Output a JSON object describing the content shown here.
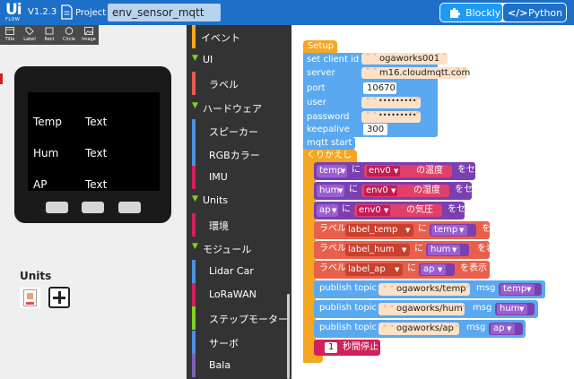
{
  "header": {
    "logo_main": "Ui",
    "logo_sub": "FLOW",
    "version": "V1.2.3",
    "project_label": "Project",
    "project_name": "env_sensor_mqtt",
    "mode_blockly": "Blockly",
    "mode_python": "Python"
  },
  "toolbox": {
    "title": "Title",
    "label": "Label",
    "rect": "Rect",
    "circle": "Circle",
    "image": "Image"
  },
  "screen": {
    "labels": [
      "Temp",
      "Hum",
      "AP"
    ],
    "values": [
      "Text",
      "Text",
      "Text"
    ]
  },
  "units": {
    "title": "Units"
  },
  "categories": [
    {
      "label": "イベント",
      "color": "#f5a623",
      "level": 0,
      "head": false
    },
    {
      "label": "UI",
      "color": "#7ed321",
      "level": 0,
      "head": true
    },
    {
      "label": "ラベル",
      "color": "#e85a4f",
      "level": 1,
      "head": false
    },
    {
      "label": "ハードウェア",
      "color": "#7ed321",
      "level": 0,
      "head": true
    },
    {
      "label": "スピーカー",
      "color": "#4a90e2",
      "level": 1,
      "head": false
    },
    {
      "label": "RGBカラー",
      "color": "#4a90e2",
      "level": 1,
      "head": false
    },
    {
      "label": "IMU",
      "color": "#d0215c",
      "level": 1,
      "head": false
    },
    {
      "label": "Units",
      "color": "#7ed321",
      "level": 0,
      "head": true
    },
    {
      "label": "環境",
      "color": "#d0215c",
      "level": 1,
      "head": false
    },
    {
      "label": "モジュール",
      "color": "#7ed321",
      "level": 0,
      "head": true
    },
    {
      "label": "Lidar Car",
      "color": "#4a90e2",
      "level": 1,
      "head": false
    },
    {
      "label": "LoRaWAN",
      "color": "#d0215c",
      "level": 1,
      "head": false
    },
    {
      "label": "ステップモーター",
      "color": "#7ed321",
      "level": 1,
      "head": false
    },
    {
      "label": "サーボ",
      "color": "#4a90e2",
      "level": 1,
      "head": false
    },
    {
      "label": "Bala",
      "color": "#7b5fb3",
      "level": 1,
      "head": false
    }
  ],
  "blocks": {
    "setup": "Setup",
    "set_client_id": "set client id",
    "client_id": "ogaworks001",
    "server": "server",
    "server_value": "m16.cloudmqtt.com",
    "port": "port",
    "port_value": "10670",
    "user": "user",
    "user_value": "•••••••••",
    "password": "password",
    "password_value": "•••••••••",
    "keepalive": "keepalive",
    "keepalive_value": "300",
    "mqtt_start": "mqtt start",
    "loop": "くりかえし",
    "var_temp": "temp",
    "var_hum": "hum",
    "var_ap": "ap",
    "ni": "に",
    "env0": "env0",
    "temp_of": "の温度",
    "hum_of": "の湿度",
    "ap_of": "の気圧",
    "set": "をセット",
    "label_word": "ラベル",
    "label_temp": "label_temp",
    "label_hum": "label_hum",
    "label_ap": "label_ap",
    "show": "を表示",
    "publish_topic": "publish topic",
    "topic_temp": "ogaworks/temp",
    "topic_hum": "ogaworks/hum",
    "topic_ap": "ogaworks/ap",
    "msg": "msg",
    "wait_value": "1",
    "wait_label": "秒間停止"
  },
  "colors": {
    "header_blue": "#1d6fc7",
    "blockly_active": "#1d9bf0",
    "event_orange": "#f5a623",
    "mqtt_blue": "#5aa9f0",
    "loop_orange": "#f5a623",
    "var_purple": "#7b3fb0",
    "label_salmon": "#e8604c",
    "wait_pink": "#d0215c"
  }
}
